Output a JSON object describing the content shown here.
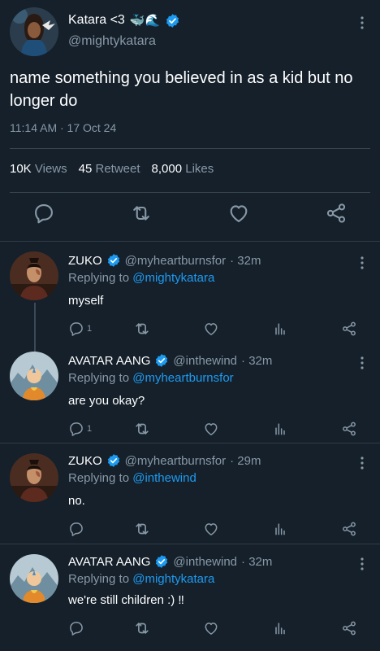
{
  "main_tweet": {
    "display_name": "Katara <3",
    "name_emoji": "🐳🌊",
    "handle": "@mightykatara",
    "text": "name something you believed in as a kid but no longer do",
    "timestamp": "11:14 AM · 17 Oct 24",
    "views_count": "10K",
    "views_label": "Views",
    "retweets_count": "45",
    "retweets_label": "Retweet",
    "likes_count": "8,000",
    "likes_label": "Likes"
  },
  "replies": [
    {
      "name": "ZUKO",
      "handle": "@myheartburnsfor",
      "time": "· 32m",
      "replying_prefix": "Replying to",
      "replying_to": "@mightykatara",
      "text": "myself",
      "reply_count": "1"
    },
    {
      "name": "AVATAR AANG",
      "handle": "@inthewind",
      "time": "· 32m",
      "replying_prefix": "Replying to",
      "replying_to": "@myheartburnsfor",
      "text": "are you okay?",
      "reply_count": "1"
    },
    {
      "name": "ZUKO",
      "handle": "@myheartburnsfor",
      "time": "· 29m",
      "replying_prefix": "Replying to",
      "replying_to": "@inthewind",
      "text": "no.",
      "reply_count": ""
    },
    {
      "name": "AVATAR AANG",
      "handle": "@inthewind",
      "time": "· 32m",
      "replying_prefix": "Replying to",
      "replying_to": "@mightykatara",
      "text": "we're still children :) ‼",
      "reply_count": ""
    }
  ],
  "icons": {
    "verified": "verified-badge-icon",
    "more": "more-vertical-icon",
    "reply": "reply-icon",
    "retweet": "retweet-icon",
    "like": "heart-icon",
    "analytics": "analytics-icon",
    "share": "share-icon"
  },
  "colors": {
    "background": "#15202b",
    "accent": "#1d9bf0",
    "muted": "#8899a6",
    "divider": "#38444d"
  }
}
